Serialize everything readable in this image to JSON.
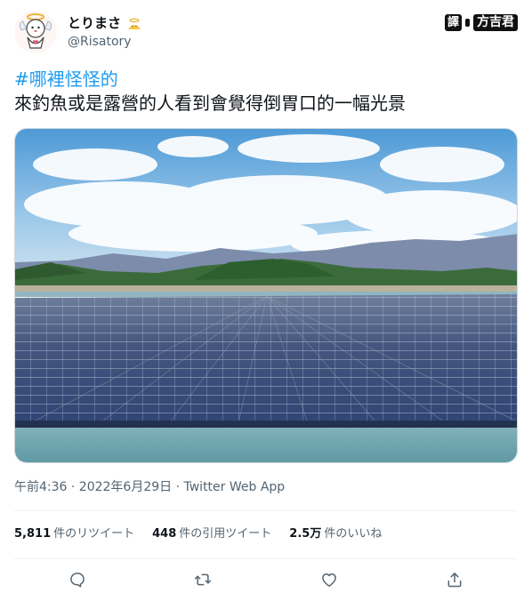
{
  "user": {
    "display_name": "とりまさ",
    "handle": "@Risatory"
  },
  "watermark": {
    "prefix": "譯",
    "author": "方吉君"
  },
  "tweet": {
    "hashtag": "#哪裡怪怪的",
    "text": "來釣魚或是露營的人看到會覺得倒胃口的一幅光景"
  },
  "meta": {
    "timestamp": "午前4:36 · 2022年6月29日 · Twitter Web App"
  },
  "stats": {
    "retweets_count": "5,811",
    "retweets_label": "件のリツイート",
    "quotes_count": "448",
    "quotes_label": "件の引用ツイート",
    "likes_count": "2.5万",
    "likes_label": "件のいいね"
  },
  "icons": {
    "reply": "reply-icon",
    "retweet": "retweet-icon",
    "like": "heart-icon",
    "share": "share-icon"
  },
  "colors": {
    "accent": "#1d9bf0",
    "muted": "#536471",
    "text": "#0f1419",
    "divider": "#eff3f4"
  }
}
